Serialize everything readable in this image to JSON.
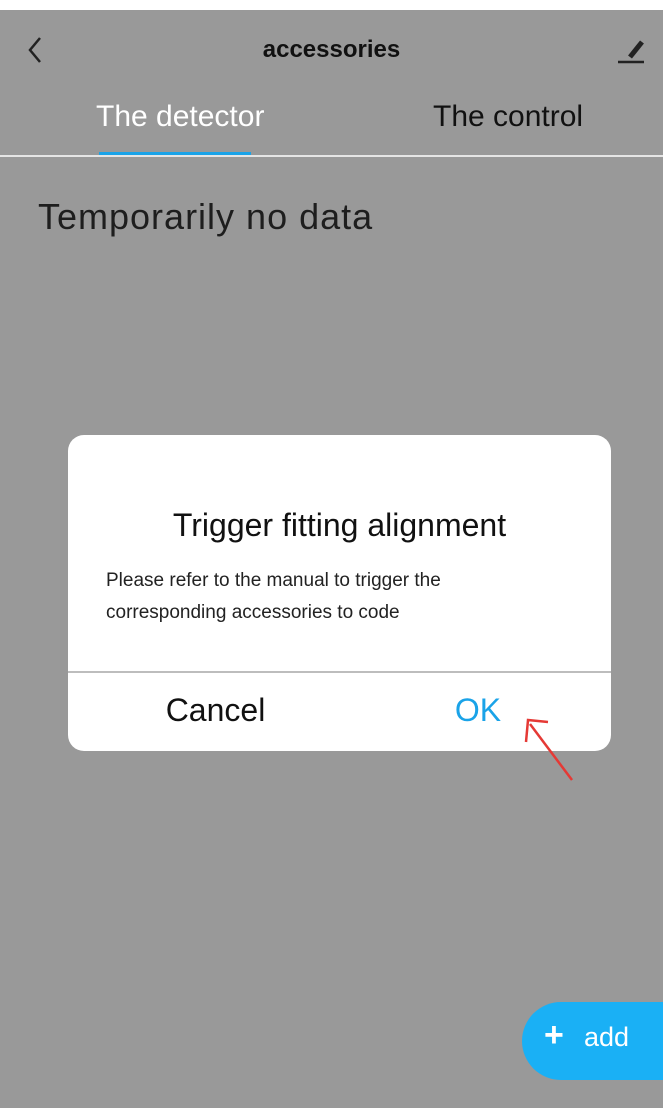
{
  "header": {
    "title": "accessories",
    "back_icon": "chevron-left-icon",
    "edit_icon": "pencil-icon"
  },
  "tabs": [
    {
      "label": "The detector",
      "active": true
    },
    {
      "label": "The control",
      "active": false
    }
  ],
  "main": {
    "empty_text": "Temporarily no data"
  },
  "dialog": {
    "title": "Trigger fitting alignment",
    "message_line1": "Please refer to the manual to trigger the",
    "message_line2": "corresponding accessories to code",
    "cancel_label": "Cancel",
    "ok_label": "OK"
  },
  "fab": {
    "plus": "+",
    "label": "add"
  },
  "colors": {
    "background": "#999999",
    "accent": "#1aa3e8",
    "fab": "#1ab0f5",
    "annotation": "#e53935"
  }
}
